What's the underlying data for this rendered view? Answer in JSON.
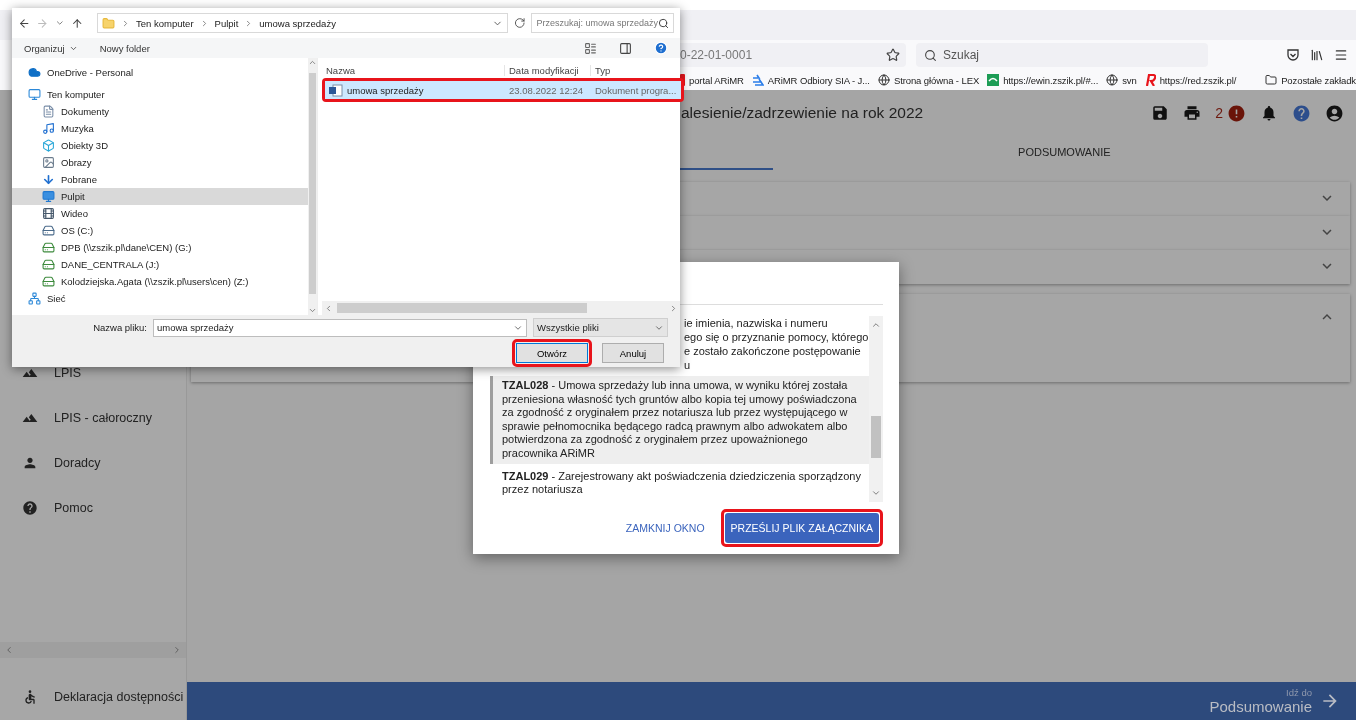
{
  "browser": {
    "url": "0-22-01-0001",
    "search": {
      "placeholder": "Szukaj"
    },
    "bookmarks": [
      {
        "label": "portal ARiMR",
        "kind": "partial"
      },
      {
        "label": "ARiMR Odbiory SIA - J...",
        "kind": "arimr"
      },
      {
        "label": "Strona główna - LEX",
        "kind": "globe"
      },
      {
        "label": "https://ewin.zszik.pl/#...",
        "kind": "ewin"
      },
      {
        "label": "svn",
        "kind": "globe"
      },
      {
        "label": "https://red.zszik.pl/",
        "kind": "red"
      }
    ],
    "other_bookmarks": "Pozostałe zakładk"
  },
  "app": {
    "title": "alesienie/zadrzewienie na rok 2022",
    "error_count": "2",
    "tabs": [
      {
        "selected": true
      },
      {
        "label": "PODSUMOWANIE",
        "selected": false
      }
    ],
    "panels": [
      {
        "expanded": false
      },
      {
        "expanded": false
      },
      {
        "expanded": false
      },
      {
        "expanded": true
      }
    ],
    "sidebar": {
      "items": [
        {
          "label": "LPIS",
          "kind": "terrain"
        },
        {
          "label": "LPIS - całoroczny",
          "kind": "terrain"
        },
        {
          "label": "Doradcy",
          "kind": "person"
        },
        {
          "label": "Pomoc",
          "kind": "help"
        }
      ],
      "footer": "Deklaracja dostępności"
    },
    "next_bar": {
      "caption": "Idź do",
      "target": "Podsumowanie"
    }
  },
  "modal": {
    "items": [
      {
        "lines": [
          "ie imienia, nazwiska i numeru",
          "ego się o przyznanie pomocy, którego",
          "e zostało zakończone postępowanie",
          "u"
        ],
        "selected": false
      },
      {
        "text": "**TZAL028** - Umowa sprzedaży lub inna umowa, w wyniku której została przeniesiona własność tych gruntów albo kopia tej umowy poświadczona za zgodność z oryginałem przez notariusza lub przez występującego w sprawie pełnomocnika będącego radcą prawnym albo adwokatem albo potwierdzona za zgodność z oryginałem przez upoważnionego pracownika ARiMR",
        "selected": true
      },
      {
        "text": "**TZAL029** - Zarejestrowany akt poświadczenia dziedziczenia sporządzony przez notariusza",
        "selected": false
      }
    ],
    "buttons": [
      {
        "label": "ZAMKNIJ OKNO",
        "kind": "text",
        "highlighted": false
      },
      {
        "label": "PRZEŚLIJ PLIK ZAŁĄCZNIKA",
        "kind": "primary",
        "highlighted": true
      }
    ]
  },
  "file_dialog": {
    "path": [
      "Ten komputer",
      "Pulpit",
      "umowa sprzedaży"
    ],
    "search": {
      "placeholder": "Przeszukaj: umowa sprzedaży"
    },
    "toolbar": {
      "organize": "Organizuj",
      "new_folder": "Nowy folder"
    },
    "tree": [
      {
        "label": "OneDrive - Personal",
        "kind": "cloud",
        "selected": false
      },
      {
        "label": "Ten komputer",
        "kind": "computer",
        "selected": false,
        "children": [
          {
            "label": "Dokumenty",
            "kind": "documents",
            "selected": false
          },
          {
            "label": "Muzyka",
            "kind": "music",
            "selected": false
          },
          {
            "label": "Obiekty 3D",
            "kind": "objects",
            "selected": false
          },
          {
            "label": "Obrazy",
            "kind": "pictures",
            "selected": false
          },
          {
            "label": "Pobrane",
            "kind": "downloads",
            "selected": false
          },
          {
            "label": "Pulpit",
            "kind": "desktop",
            "selected": true
          },
          {
            "label": "Wideo",
            "kind": "video",
            "selected": false
          },
          {
            "label": "OS (C:)",
            "kind": "drive",
            "selected": false
          },
          {
            "label": "DPB (\\\\zszik.pl\\dane\\CEN) (G:)",
            "kind": "netdrive",
            "selected": false
          },
          {
            "label": "DANE_CENTRALA (J:)",
            "kind": "netdrive",
            "selected": false
          },
          {
            "label": "Kolodziejska.Agata (\\\\zszik.pl\\users\\cen) (Z:)",
            "kind": "netdrive",
            "selected": false
          }
        ]
      },
      {
        "label": "Sieć",
        "kind": "network",
        "selected": false
      }
    ],
    "columns": [
      "Nazwa",
      "Data modyfikacji",
      "Typ"
    ],
    "files": [
      {
        "name": "umowa sprzedaży",
        "date": "23.08.2022 12:24",
        "type": "Dokument progra...",
        "selected": true,
        "highlighted": true
      }
    ],
    "filename_label": "Nazwa pliku:",
    "filename": "umowa sprzedaży",
    "filter": "Wszystkie pliki",
    "buttons": [
      {
        "label": "Otwórz",
        "kind": "default",
        "highlighted": true
      },
      {
        "label": "Anuluj",
        "kind": "normal",
        "highlighted": false
      }
    ]
  }
}
